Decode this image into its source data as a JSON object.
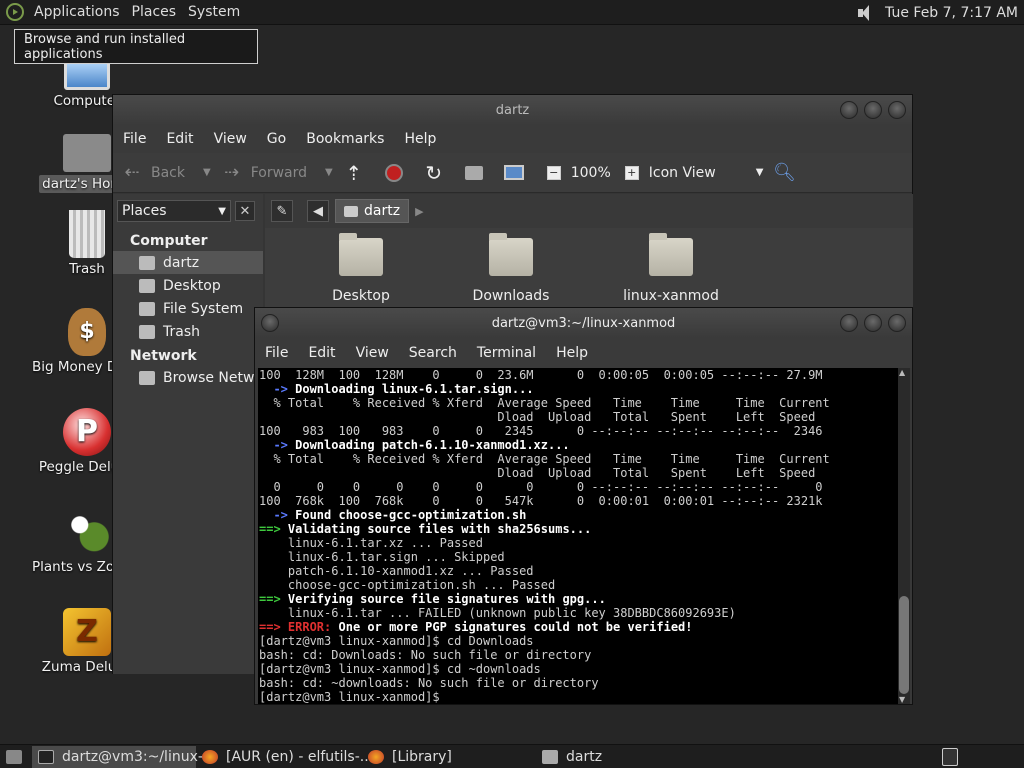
{
  "top_panel": {
    "menus": [
      "Applications",
      "Places",
      "System"
    ],
    "clock": "Tue Feb  7, 7:17 AM"
  },
  "tooltip": "Browse and run installed applications",
  "desktop_icons": [
    {
      "label": "Computer",
      "icon": "computer-icon"
    },
    {
      "label": "dartz's Home",
      "icon": "home-folder-icon"
    },
    {
      "label": "Trash",
      "icon": "trash-icon"
    },
    {
      "label": "Big Money Deluxe",
      "icon": "big-money-icon"
    },
    {
      "label": "Peggle Deluxe",
      "icon": "peggle-icon"
    },
    {
      "label": "Plants vs Zombies",
      "icon": "plants-vs-zombies-icon"
    },
    {
      "label": "Zuma Deluxe",
      "icon": "zuma-icon"
    }
  ],
  "file_manager": {
    "title": "dartz",
    "menu": [
      "File",
      "Edit",
      "View",
      "Go",
      "Bookmarks",
      "Help"
    ],
    "toolbar": {
      "back": "Back",
      "forward": "Forward",
      "zoom": "100%",
      "view_mode": "Icon View"
    },
    "sidebar": {
      "combo": "Places",
      "computer_heading": "Computer",
      "computer_items": [
        "dartz",
        "Desktop",
        "File System",
        "Trash"
      ],
      "network_heading": "Network",
      "network_items": [
        "Browse Network"
      ]
    },
    "location": "dartz",
    "folders": [
      "Desktop",
      "Downloads",
      "linux-xanmod"
    ]
  },
  "terminal": {
    "title": "dartz@vm3:~/linux-xanmod",
    "menu": [
      "File",
      "Edit",
      "View",
      "Search",
      "Terminal",
      "Help"
    ],
    "lines": [
      {
        "t": "100  128M  100  128M    0     0  23.6M      0  0:00:05  0:00:05 --:--:-- 27.9M"
      },
      {
        "p": "  -> ",
        "pc": "blu",
        "t": "Downloading linux-6.1.tar.sign...",
        "b": true
      },
      {
        "t": "  % Total    % Received % Xferd  Average Speed   Time    Time     Time  Current"
      },
      {
        "t": "                                 Dload  Upload   Total   Spent    Left  Speed"
      },
      {
        "t": "100   983  100   983    0     0   2345      0 --:--:-- --:--:-- --:--:--  2346"
      },
      {
        "p": "  -> ",
        "pc": "blu",
        "t": "Downloading patch-6.1.10-xanmod1.xz...",
        "b": true
      },
      {
        "t": "  % Total    % Received % Xferd  Average Speed   Time    Time     Time  Current"
      },
      {
        "t": "                                 Dload  Upload   Total   Spent    Left  Speed"
      },
      {
        "t": "  0     0    0     0    0     0      0      0 --:--:-- --:--:-- --:--:--     0"
      },
      {
        "t": "100  768k  100  768k    0     0   547k      0  0:00:01  0:00:01 --:--:-- 2321k"
      },
      {
        "p": "  -> ",
        "pc": "blu",
        "t": "Found choose-gcc-optimization.sh",
        "b": true
      },
      {
        "p": "==> ",
        "pc": "grn",
        "t": "Validating source files with sha256sums...",
        "b": true
      },
      {
        "t": "    linux-6.1.tar.xz ... Passed"
      },
      {
        "t": "    linux-6.1.tar.sign ... Skipped"
      },
      {
        "t": "    patch-6.1.10-xanmod1.xz ... Passed"
      },
      {
        "t": "    choose-gcc-optimization.sh ... Passed"
      },
      {
        "p": "==> ",
        "pc": "grn",
        "t": "Verifying source file signatures with gpg...",
        "b": true
      },
      {
        "t": "    linux-6.1.tar ... FAILED (unknown public key 38DBBDC86092693E)"
      },
      {
        "p": "==> ",
        "pc": "red",
        "e": "ERROR:",
        "t": " One or more PGP signatures could not be verified!",
        "b": true
      },
      {
        "t": "[dartz@vm3 linux-xanmod]$ cd Downloads"
      },
      {
        "t": "bash: cd: Downloads: No such file or directory"
      },
      {
        "t": "[dartz@vm3 linux-xanmod]$ cd ~downloads"
      },
      {
        "t": "bash: cd: ~downloads: No such file or directory"
      },
      {
        "t": "[dartz@vm3 linux-xanmod]$ "
      }
    ]
  },
  "taskbar": {
    "tasks": [
      "dartz@vm3:~/linux-...",
      "[AUR (en) - elfutils-...",
      "[Library]",
      "dartz"
    ]
  }
}
